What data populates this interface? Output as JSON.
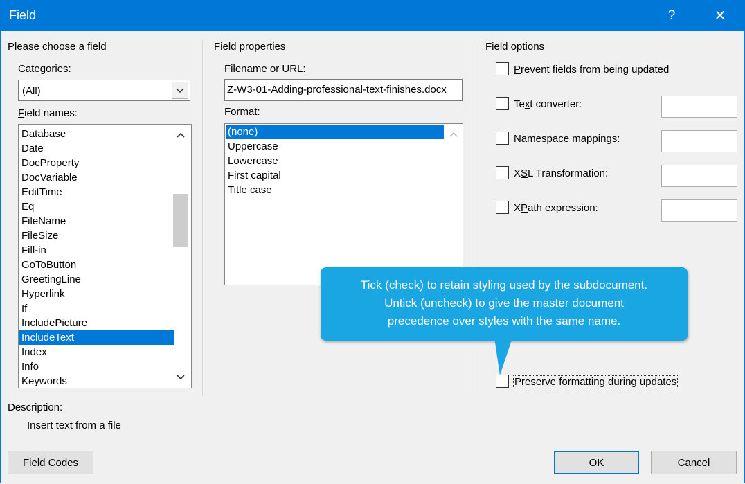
{
  "window": {
    "title": "Field",
    "help_icon": "?",
    "close_icon": "✕"
  },
  "left": {
    "group_title": "Please choose a field",
    "categories_label": {
      "accel": "C",
      "rest": "ategories:"
    },
    "categories_value": "(All)",
    "field_names_label": {
      "accel": "F",
      "rest": "ield names:"
    },
    "field_names": [
      "Database",
      "Date",
      "DocProperty",
      "DocVariable",
      "EditTime",
      "Eq",
      "FileName",
      "FileSize",
      "Fill-in",
      "GoToButton",
      "GreetingLine",
      "Hyperlink",
      "If",
      "IncludePicture",
      "IncludeText",
      "Index",
      "Info",
      "Keywords"
    ],
    "selected_field": "IncludeText",
    "description_label": "Description:",
    "description_text": "Insert text from a file"
  },
  "middle": {
    "group_title": "Field properties",
    "filename_label": {
      "pre": "Filename or URL",
      "accel": ":"
    },
    "filename_value": "Z-W3-01-Adding-professional-text-finishes.docx",
    "format_label": {
      "pre": "Forma",
      "accel": "t",
      "post": ":"
    },
    "format_options": [
      "(none)",
      "Uppercase",
      "Lowercase",
      "First capital",
      "Title case"
    ],
    "selected_format": "(none)"
  },
  "right": {
    "group_title": "Field options",
    "prevent": {
      "accel": "P",
      "rest": "revent fields from being updated"
    },
    "text_converter": {
      "pre": "Te",
      "accel": "x",
      "post": "t converter:"
    },
    "namespace": {
      "accel": "N",
      "rest": "amespace mappings:"
    },
    "xsl": {
      "pre": "X",
      "accel": "S",
      "post": "L Transformation:"
    },
    "xpath": {
      "pre": "X",
      "accel": "P",
      "post": "ath expression:"
    },
    "preserve": {
      "pre": "Pre",
      "accel": "s",
      "post": "erve formatting during updates"
    }
  },
  "callout": {
    "line1": "Tick (check) to retain styling used by the subdocument.",
    "line2": "Untick (uncheck) to give the master document",
    "line3": "precedence over styles with the same name.",
    "color": "#1aa5e3"
  },
  "buttons": {
    "field_codes": {
      "pre": "Fi",
      "accel": "e",
      "post": "ld Codes"
    },
    "ok": "OK",
    "cancel": "Cancel"
  },
  "colors": {
    "accent": "#0078d7",
    "background": "#f0f0f0"
  }
}
